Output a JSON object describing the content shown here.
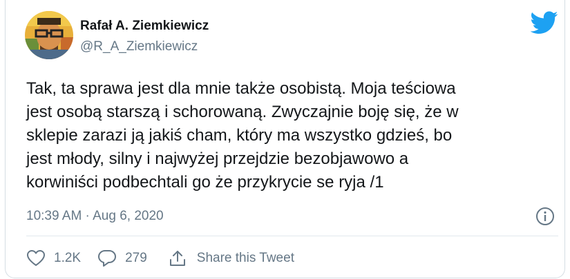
{
  "author": {
    "name": "Rafał A. Ziemkiewicz",
    "handle": "@R_A_Ziemkiewicz",
    "avatar_icon": "profile-photo"
  },
  "tweet": {
    "lines": [
      "Tak, ta sprawa jest dla mnie także osobistą. Moja teściowa",
      "jest osobą starszą i schorowaną. Zwyczajnie boję się, że w",
      "sklepie zarazi ją jakiś cham, który ma wszystko gdzieś, bo",
      "jest młody, silny i najwyżej przejdzie bezobjawowo a",
      "korwiniści podbechtali go że przykrycie se ryja /1"
    ],
    "timestamp": "10:39 AM · Aug 6, 2020"
  },
  "actions": {
    "like_count": "1.2K",
    "reply_count": "279",
    "share_label": "Share this Tweet"
  },
  "icons": {
    "brand": "twitter-bird-icon",
    "info": "info-icon",
    "like": "heart-icon",
    "reply": "comment-bubble-icon",
    "share": "share-icon"
  },
  "colors": {
    "twitter_blue": "#1da1f2",
    "text_primary": "#14171a",
    "text_secondary": "#657786",
    "divider": "#e1e8ed"
  }
}
